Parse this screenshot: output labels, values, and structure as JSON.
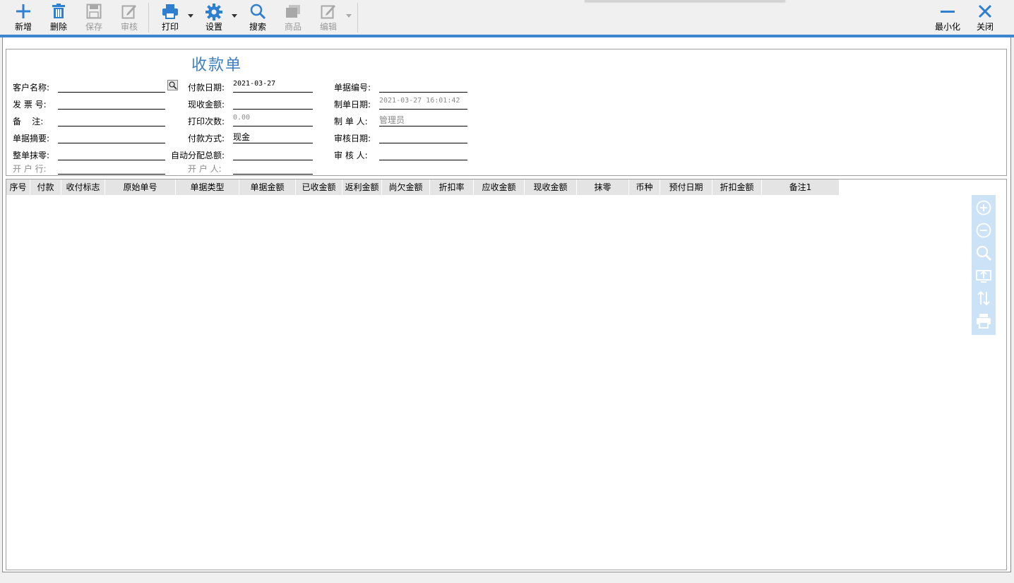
{
  "toolbar": {
    "buttons": [
      {
        "label": "新增",
        "icon": "plus-icon",
        "enabled": true
      },
      {
        "label": "删除",
        "icon": "trash-icon",
        "enabled": true
      },
      {
        "label": "保存",
        "icon": "save-icon",
        "enabled": false
      },
      {
        "label": "审核",
        "icon": "edit-icon",
        "enabled": false
      },
      {
        "label": "打印",
        "icon": "printer-icon",
        "enabled": true,
        "dropdown": true
      },
      {
        "label": "设置",
        "icon": "gear-icon",
        "enabled": true,
        "dropdown": true
      },
      {
        "label": "搜索",
        "icon": "search-icon",
        "enabled": true
      },
      {
        "label": "商品",
        "icon": "product-icon",
        "enabled": false
      },
      {
        "label": "编辑",
        "icon": "edit-icon",
        "enabled": false,
        "dropdown": true
      }
    ],
    "minimize_label": "最小化",
    "close_label": "关闭",
    "accent_color": "#3c86cf"
  },
  "form": {
    "title": "收款单",
    "fields": {
      "customer_name": {
        "label": "客户名称:",
        "value": ""
      },
      "invoice_no": {
        "label": "发 票 号:",
        "value": ""
      },
      "remark": {
        "label": "备    注:",
        "value": ""
      },
      "summary": {
        "label": "单据摘要:",
        "value": ""
      },
      "rounding": {
        "label": "整单抹零:",
        "value": ""
      },
      "bank": {
        "label": "开 户 行:",
        "value": ""
      },
      "pay_date": {
        "label": "付款日期:",
        "value": "2021-03-27"
      },
      "received_amount": {
        "label": "现收金额:",
        "value": ""
      },
      "print_count": {
        "label": "打印次数:",
        "value": "0.00"
      },
      "pay_method": {
        "label": "付款方式:",
        "value": "现金"
      },
      "auto_alloc": {
        "label": "自动分配总额:",
        "value": ""
      },
      "account_holder": {
        "label": "开 户 人:",
        "value": ""
      },
      "doc_no": {
        "label": "单据编号:",
        "value": ""
      },
      "create_date": {
        "label": "制单日期:",
        "value": "2021-03-27 16:01:42"
      },
      "creator": {
        "label": "制 单 人:",
        "value": "管理员"
      },
      "audit_date": {
        "label": "审核日期:",
        "value": ""
      },
      "auditor": {
        "label": "审 核 人:",
        "value": ""
      }
    }
  },
  "grid": {
    "columns": [
      "序号",
      "付款",
      "收付标志",
      "原始单号",
      "单据类型",
      "单据金额",
      "已收金额",
      "返利金额",
      "尚欠金额",
      "折扣率",
      "应收金额",
      "现收金额",
      "抹零",
      "币种",
      "预付日期",
      "折扣金额",
      "备注1"
    ],
    "rows": []
  },
  "side_tools": [
    "zoom-in-icon",
    "zoom-out-icon",
    "search-icon",
    "screen-share-icon",
    "sort-icon",
    "printer-icon"
  ]
}
